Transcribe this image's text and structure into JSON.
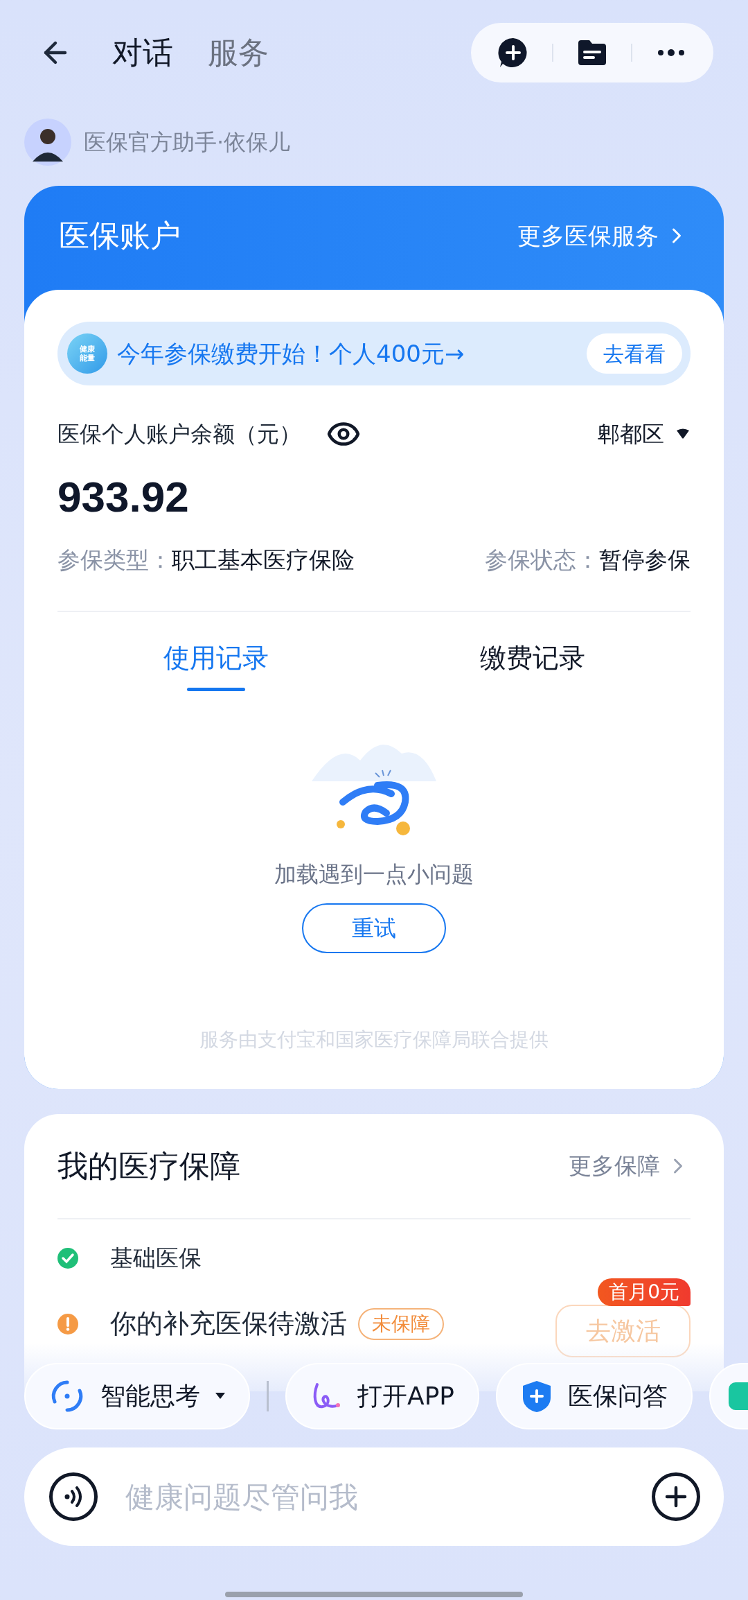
{
  "header": {
    "tabs": [
      {
        "label": "对话",
        "selected": true
      },
      {
        "label": "服务",
        "selected": false
      }
    ]
  },
  "assistant": {
    "name": "医保官方助手·依保儿"
  },
  "account_card": {
    "title": "医保账户",
    "more_link": "更多医保服务",
    "banner": {
      "badge_lines": [
        "健康",
        "能量"
      ],
      "text": "今年参保缴费开始！个人400元→",
      "button": "去看看"
    },
    "balance_label": "医保个人账户余额（元）",
    "region": "郫都区",
    "balance": "933.92",
    "type_label": "参保类型：",
    "type_value": "职工基本医疗保险",
    "status_label": "参保状态：",
    "status_value": "暂停参保",
    "tabs": [
      {
        "label": "使用记录",
        "selected": true
      },
      {
        "label": "缴费记录",
        "selected": false
      }
    ],
    "empty_state": {
      "message": "加载遇到一点小问题",
      "retry": "重试"
    },
    "footer": "服务由支付宝和国家医疗保障局联合提供"
  },
  "coverage_card": {
    "title": "我的医疗保障",
    "more_link": "更多保障",
    "items": [
      {
        "kind": "covered",
        "name": "基础医保"
      },
      {
        "kind": "pending",
        "name": "你的补充医保待激活",
        "tag": "未保障",
        "action": "去激活",
        "promo": "首月0元"
      }
    ]
  },
  "chips": [
    {
      "kind": "thinking",
      "label": "智能思考"
    },
    {
      "kind": "app",
      "label": "打开APP"
    },
    {
      "kind": "qa",
      "label": "医保问答"
    },
    {
      "kind": "cutoff"
    }
  ],
  "input": {
    "placeholder": "健康问题尽管问我"
  }
}
